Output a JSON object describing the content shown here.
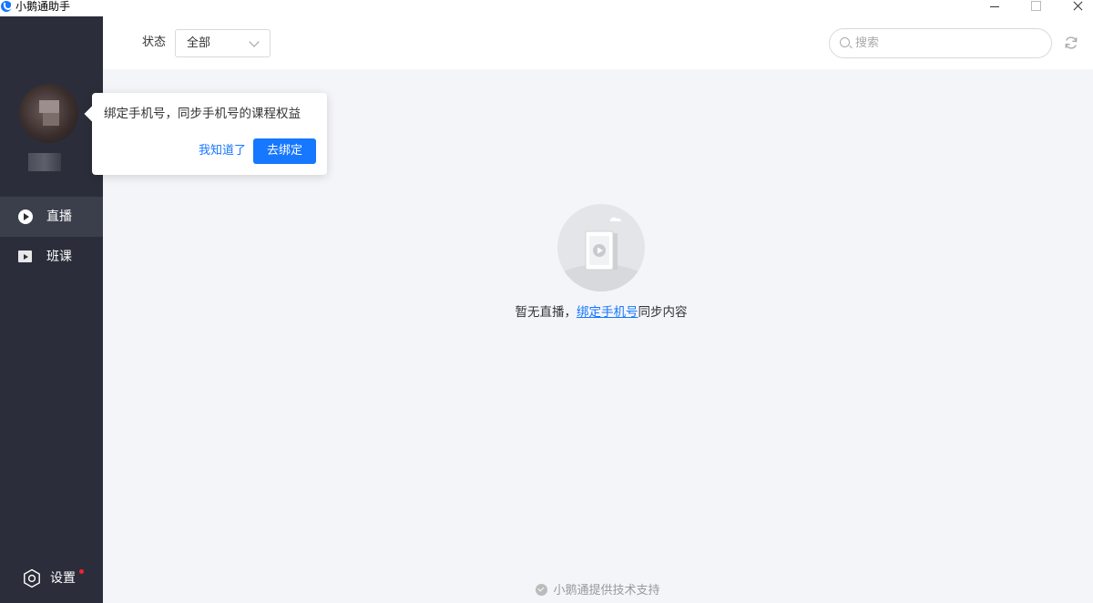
{
  "window": {
    "title": "小鹅通助手"
  },
  "sidebar": {
    "items": [
      {
        "label": "直播",
        "icon": "play-circle-icon",
        "active": true
      },
      {
        "label": "班课",
        "icon": "class-board-icon",
        "active": false
      }
    ],
    "settings": {
      "label": "设置",
      "icon": "gear-icon",
      "has_notification": true
    }
  },
  "toolbar": {
    "status_label": "状态",
    "status_value": "全部",
    "search_placeholder": "搜索",
    "search_value": ""
  },
  "popover": {
    "message": "绑定手机号，同步手机号的课程权益",
    "dismiss_label": "我知道了",
    "bind_label": "去绑定"
  },
  "empty_state": {
    "text_before": "暂无直播，",
    "link": "绑定手机号",
    "text_after": "同步内容"
  },
  "footer": {
    "text": "小鹅通提供技术支持"
  },
  "colors": {
    "sidebar_bg": "#2b2e3a",
    "sidebar_active": "#3b3f4c",
    "accent": "#1677ff",
    "content_bg": "#f4f5f9",
    "notification": "#f5222d"
  }
}
